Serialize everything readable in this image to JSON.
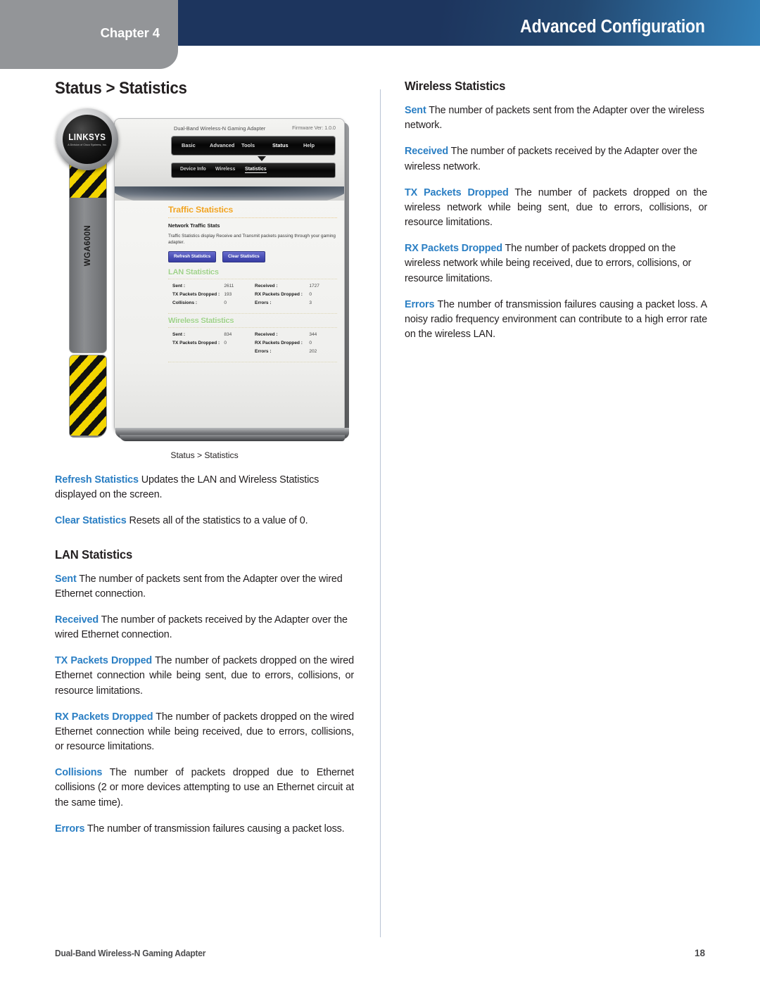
{
  "header": {
    "chapter_label": "Chapter 4",
    "title": "Advanced Configuration",
    "band_color": "#1d355e",
    "tab_color": "#939598"
  },
  "left_column": {
    "heading": "Status > Statistics",
    "figure_caption": "Status > Statistics",
    "paragraphs": [
      {
        "term": "Refresh Statistics",
        "text": "Updates the LAN and Wireless Statistics displayed on the screen."
      },
      {
        "term": "Clear Statistics",
        "text": "Resets all of the statistics to a value of 0."
      }
    ],
    "subheading": "LAN Statistics",
    "lan_paragraphs": [
      {
        "term": "Sent",
        "text": "The number of packets sent from the Adapter over the wired Ethernet connection."
      },
      {
        "term": "Received",
        "text": "The number of packets received by the Adapter over the wired Ethernet connection."
      },
      {
        "term": "TX Packets Dropped",
        "text": "The number of packets dropped on the wired Ethernet connection while being sent, due to errors, collisions, or resource limitations."
      },
      {
        "term": "RX Packets Dropped",
        "text": "The number of packets dropped on the wired Ethernet connection while being received, due to errors, collisions, or resource limitations."
      },
      {
        "term": "Collisions",
        "text": "The number of packets dropped due to Ethernet collisions (2 or more devices attempting to use an Ethernet circuit at the same time)."
      },
      {
        "term": "Errors",
        "text": "The number of transmission failures causing a packet loss."
      }
    ]
  },
  "right_column": {
    "subheading": "Wireless Statistics",
    "paragraphs": [
      {
        "term": "Sent",
        "text": "The number of packets sent from the Adapter over the wireless network."
      },
      {
        "term": "Received",
        "text": "The number of packets received by the Adapter over the wireless network."
      },
      {
        "term": "TX Packets Dropped",
        "text": "The number of packets dropped on the wireless network while being sent, due to errors, collisions, or resource limitations."
      },
      {
        "term": "RX Packets Dropped",
        "text": "The number of packets dropped on the wireless network while being received, due to errors, collisions, or resource limitations."
      },
      {
        "term": "Errors",
        "text": "The number of transmission failures causing a packet loss. A noisy radio frequency environment can contribute to a high error rate on the wireless LAN."
      }
    ]
  },
  "figure": {
    "device": {
      "brand": "LINKSYS",
      "brand_sub": "A Division of Cisco Systems, Inc.",
      "model": "WGA600N"
    },
    "ui": {
      "product_title": "Dual-Band Wireless-N Gaming Adapter",
      "firmware": "Firmware Ver: 1.0.0",
      "nav": [
        "Basic",
        "Advanced",
        "Tools",
        "Status",
        "Help"
      ],
      "nav_active": "Status",
      "tabs": [
        "Device Info",
        "Wireless",
        "Statistics"
      ],
      "tabs_active": "Statistics",
      "panel_title": "Traffic Statistics",
      "panel_sub": "Network Traffic Stats",
      "panel_desc": "Traffic Statistics display Receive and Transmit packets passing through your gaming adapter.",
      "buttons": [
        "Refresh Statistics",
        "Clear Statistics"
      ],
      "lan_section": "LAN Statistics",
      "lan_rows": [
        {
          "l1": "Sent :",
          "v1": "2611",
          "l2": "Received :",
          "v2": "1727"
        },
        {
          "l1": "TX Packets Dropped :",
          "v1": "193",
          "l2": "RX Packets Dropped :",
          "v2": "0"
        },
        {
          "l1": "Collisions :",
          "v1": "0",
          "l2": "Errors :",
          "v2": "3"
        }
      ],
      "wireless_section": "Wireless Statistics",
      "wireless_rows": [
        {
          "l1": "Sent :",
          "v1": "834",
          "l2": "Received :",
          "v2": "344"
        },
        {
          "l1": "TX Packets Dropped :",
          "v1": "0",
          "l2": "RX Packets Dropped :",
          "v2": "0"
        },
        {
          "l1": "",
          "v1": "",
          "l2": "Errors :",
          "v2": "202"
        }
      ]
    }
  },
  "footer": {
    "product": "Dual-Band Wireless-N Gaming Adapter",
    "page_number": "18"
  }
}
